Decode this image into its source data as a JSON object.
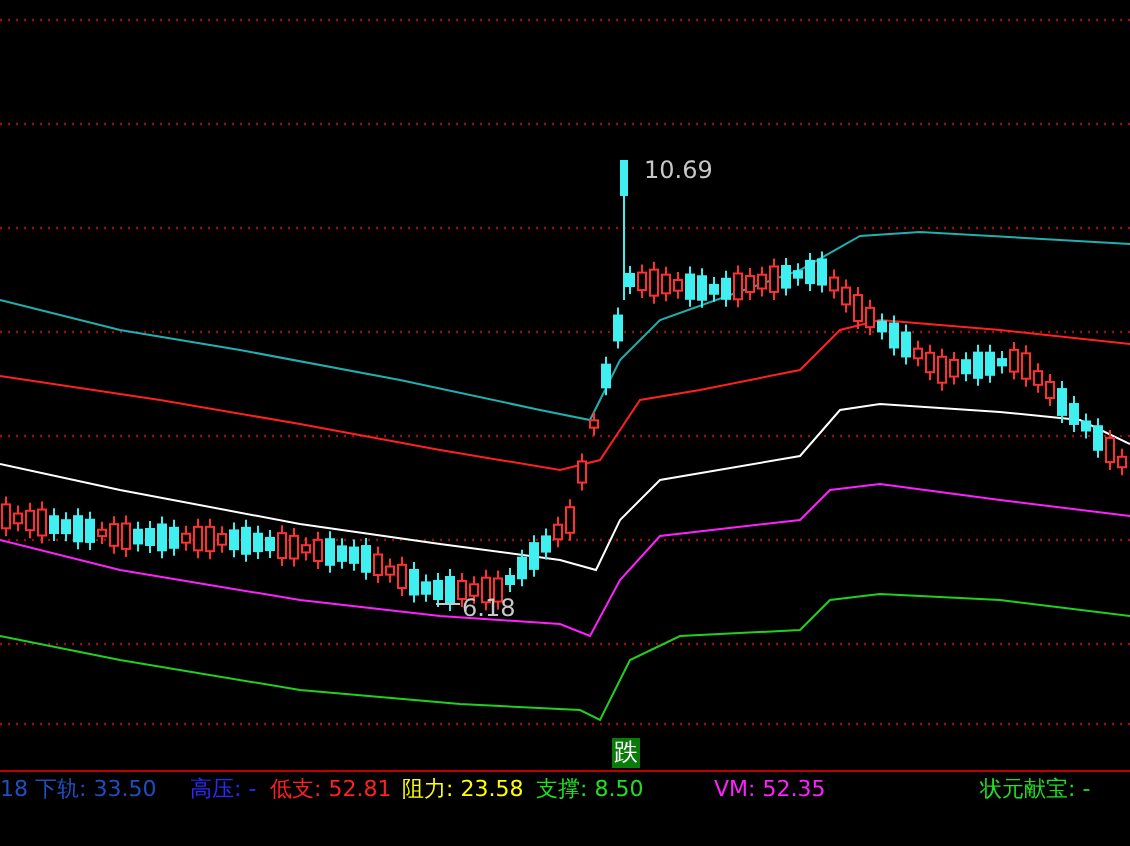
{
  "chart": {
    "high_label": "10.69",
    "low_label": "6.18",
    "signal_badge": "跌"
  },
  "indicators": [
    {
      "label": "18 下轨:",
      "value": "33.50",
      "color": "#1e4fc0"
    },
    {
      "label": "高压:",
      "value": "-",
      "color": "#2a2aff"
    },
    {
      "label": "低支:",
      "value": "52.81",
      "color": "#ff2020"
    },
    {
      "label": "阻力:",
      "value": "23.58",
      "color": "#ffff00"
    },
    {
      "label": "支撑:",
      "value": "8.50",
      "color": "#20e020"
    },
    {
      "label": "VM:",
      "value": "52.35",
      "color": "#ff20ff"
    },
    {
      "label": "状元献宝:",
      "value": "-",
      "color": "#20e020"
    }
  ]
}
